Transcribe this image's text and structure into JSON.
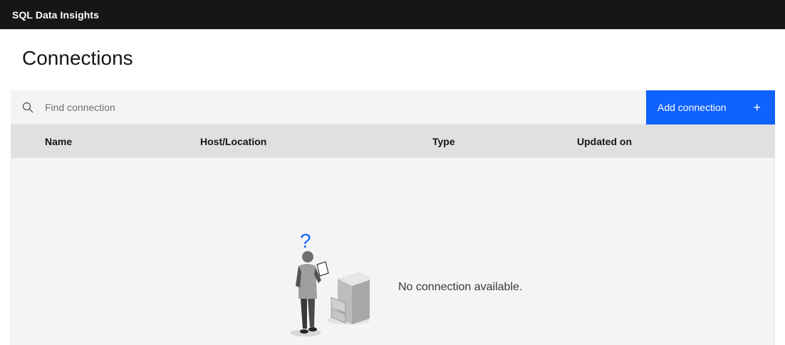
{
  "header": {
    "app_title": "SQL Data Insights"
  },
  "page": {
    "title": "Connections"
  },
  "search": {
    "placeholder": "Find connection",
    "value": ""
  },
  "toolbar": {
    "add_label": "Add connection",
    "add_icon": "+"
  },
  "table": {
    "columns": [
      "Name",
      "Host/Location",
      "Type",
      "Updated on"
    ],
    "rows": []
  },
  "empty_state": {
    "message": "No connection available.",
    "icon": "?"
  },
  "colors": {
    "topbar": "#161616",
    "accent": "#0f62fe",
    "header_row": "#e0e0e0",
    "surface": "#f4f4f4"
  }
}
